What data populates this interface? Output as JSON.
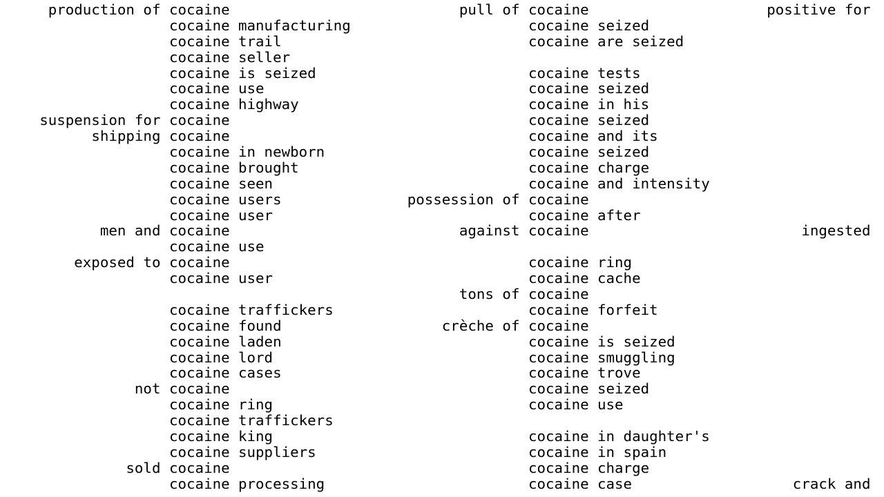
{
  "keyword": "cocaine",
  "columns": [
    {
      "lines": [
        {
          "left": "production of",
          "right": ""
        },
        {
          "left": "",
          "right": "manufacturing"
        },
        {
          "left": "",
          "right": "trail"
        },
        {
          "left": "",
          "right": "seller"
        },
        {
          "left": "",
          "right": "is seized"
        },
        {
          "left": "",
          "right": "use"
        },
        {
          "left": "",
          "right": "highway"
        },
        {
          "left": "suspension for",
          "right": ""
        },
        {
          "left": "shipping",
          "right": ""
        },
        {
          "left": "",
          "right": "in newborn"
        },
        {
          "left": "",
          "right": "brought"
        },
        {
          "left": "",
          "right": "seen"
        },
        {
          "left": "",
          "right": "users"
        },
        {
          "left": "",
          "right": "user"
        },
        {
          "left": "men and",
          "right": ""
        },
        {
          "left": "",
          "right": "use"
        },
        {
          "left": "exposed to",
          "right": ""
        },
        {
          "left": "",
          "right": "user"
        },
        {
          "blank": true
        },
        {
          "left": "",
          "right": "traffickers"
        },
        {
          "left": "",
          "right": "found"
        },
        {
          "left": "",
          "right": "laden"
        },
        {
          "left": "",
          "right": "lord"
        },
        {
          "left": "",
          "right": "cases"
        },
        {
          "left": "not",
          "right": ""
        },
        {
          "left": "",
          "right": "ring"
        },
        {
          "left": "",
          "right": "traffickers"
        },
        {
          "left": "",
          "right": "king"
        },
        {
          "left": "",
          "right": "suppliers"
        },
        {
          "left": "sold",
          "right": ""
        },
        {
          "left": "",
          "right": "processing"
        }
      ]
    },
    {
      "lines": [
        {
          "left": "pull of",
          "right": ""
        },
        {
          "left": "",
          "right": "seized"
        },
        {
          "left": "",
          "right": "are seized"
        },
        {
          "blank": true
        },
        {
          "left": "",
          "right": "tests"
        },
        {
          "left": "",
          "right": "seized"
        },
        {
          "left": "",
          "right": "in his"
        },
        {
          "left": "",
          "right": "seized"
        },
        {
          "left": "",
          "right": "and its"
        },
        {
          "left": "",
          "right": "seized"
        },
        {
          "left": "",
          "right": "charge"
        },
        {
          "left": "",
          "right": "and intensity"
        },
        {
          "left": "possession of",
          "right": ""
        },
        {
          "left": "",
          "right": "after"
        },
        {
          "left": "against",
          "right": ""
        },
        {
          "blank": true
        },
        {
          "left": "",
          "right": "ring"
        },
        {
          "left": "",
          "right": "cache"
        },
        {
          "left": "tons of",
          "right": ""
        },
        {
          "left": "",
          "right": "forfeit"
        },
        {
          "left": "crèche of",
          "right": ""
        },
        {
          "left": "",
          "right": "is seized"
        },
        {
          "left": "",
          "right": "smuggling"
        },
        {
          "left": "",
          "right": "trove"
        },
        {
          "left": "",
          "right": "seized"
        },
        {
          "left": "",
          "right": "use"
        },
        {
          "blank": true
        },
        {
          "left": "",
          "right": "in daughter's"
        },
        {
          "left": "",
          "right": "in spain"
        },
        {
          "left": "",
          "right": "charge"
        },
        {
          "left": "",
          "right": "case"
        }
      ]
    },
    {
      "lines": [
        {
          "left": "positive for"
        },
        {
          "blank": true
        },
        {
          "blank": true
        },
        {
          "blank": true
        },
        {
          "blank": true
        },
        {
          "blank": true
        },
        {
          "blank": true
        },
        {
          "blank": true
        },
        {
          "blank": true
        },
        {
          "blank": true
        },
        {
          "blank": true
        },
        {
          "blank": true
        },
        {
          "blank": true
        },
        {
          "blank": true
        },
        {
          "left": "ingested"
        },
        {
          "blank": true
        },
        {
          "blank": true
        },
        {
          "blank": true
        },
        {
          "blank": true
        },
        {
          "blank": true
        },
        {
          "blank": true
        },
        {
          "blank": true
        },
        {
          "blank": true
        },
        {
          "blank": true
        },
        {
          "blank": true
        },
        {
          "blank": true
        },
        {
          "blank": true
        },
        {
          "blank": true
        },
        {
          "blank": true
        },
        {
          "blank": true
        },
        {
          "left": "crack and"
        }
      ]
    }
  ]
}
